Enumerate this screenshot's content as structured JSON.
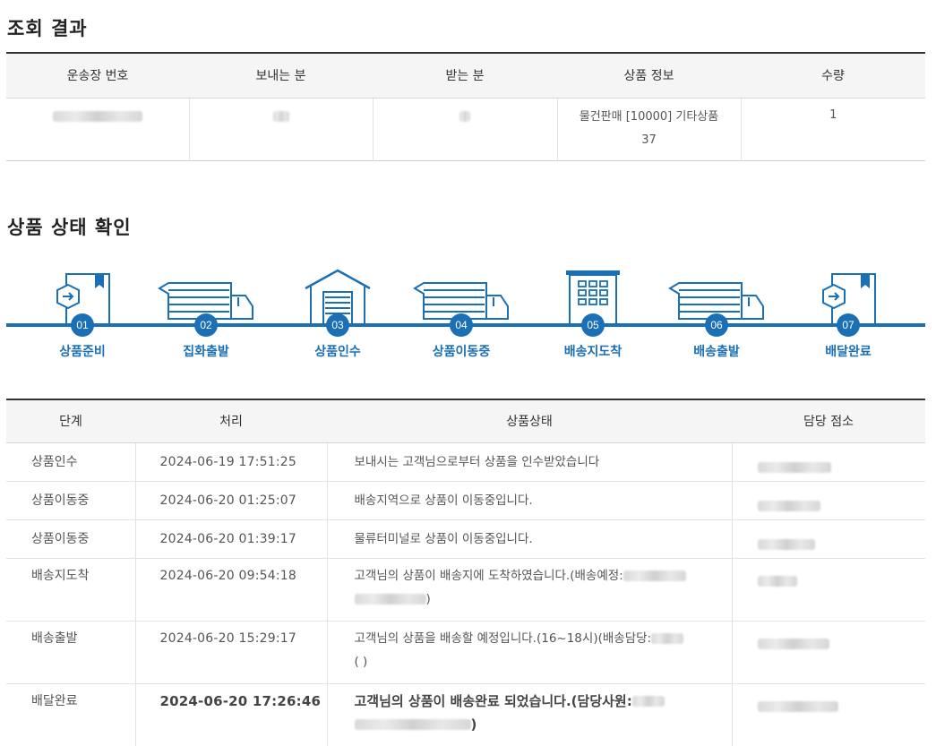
{
  "result": {
    "title": "조회 결과",
    "headers": [
      "운송장 번호",
      "보내는 분",
      "받는 분",
      "상품 정보",
      "수량"
    ],
    "product_info_line1": "물건판매 [10000] 기타상품",
    "product_info_line2": "37",
    "quantity": "1"
  },
  "status": {
    "title": "상품 상태 확인",
    "steps": [
      {
        "num": "01",
        "label": "상품준비",
        "icon": "box-icon"
      },
      {
        "num": "02",
        "label": "집화출발",
        "icon": "truck-icon"
      },
      {
        "num": "03",
        "label": "상품인수",
        "icon": "warehouse-icon"
      },
      {
        "num": "04",
        "label": "상품이동중",
        "icon": "truck-icon"
      },
      {
        "num": "05",
        "label": "배송지도착",
        "icon": "building-icon"
      },
      {
        "num": "06",
        "label": "배송출발",
        "icon": "truck-icon"
      },
      {
        "num": "07",
        "label": "배달완료",
        "icon": "box-icon"
      }
    ],
    "color": "#1a6fb5"
  },
  "history": {
    "headers": [
      "단계",
      "처리",
      "상품상태",
      "담당 점소"
    ],
    "rows": [
      {
        "stage": "상품인수",
        "time": "2024-06-19 17:51:25",
        "desc1": "보내시는 고객님으로부터 상품을 인수받았습니다",
        "desc2": ""
      },
      {
        "stage": "상품이동중",
        "time": "2024-06-20 01:25:07",
        "desc1": "배송지역으로 상품이 이동중입니다.",
        "desc2": ""
      },
      {
        "stage": "상품이동중",
        "time": "2024-06-20 01:39:17",
        "desc1": "물류터미널로 상품이 이동중입니다.",
        "desc2": ""
      },
      {
        "stage": "배송지도착",
        "time": "2024-06-20 09:54:18",
        "desc1": "고객님의 상품이 배송지에 도착하였습니다.(배송예정:",
        "desc2": ")"
      },
      {
        "stage": "배송출발",
        "time": "2024-06-20 15:29:17",
        "desc1": "고객님의 상품을 배송할 예정입니다.(16~18시)(배송담당:",
        "desc2": "(                           )"
      },
      {
        "stage": "배달완료",
        "time": "2024-06-20 17:26:46",
        "desc1": "고객님의 상품이 배송완료 되었습니다.(담당사원:",
        "desc2": ")"
      }
    ]
  }
}
